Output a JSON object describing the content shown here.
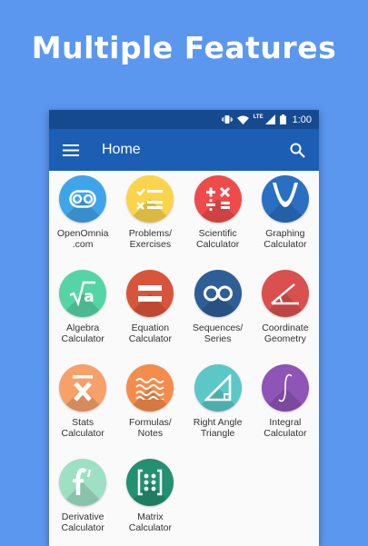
{
  "headline": "Multiple Features",
  "status_bar": {
    "network": "LTE",
    "time": "1:00"
  },
  "toolbar": {
    "title": "Home"
  },
  "colors": {
    "background": "#5b97ef",
    "status_bar": "#164a90",
    "app_bar": "#1b5eb4",
    "content": "#fafafa"
  },
  "features": [
    {
      "line1": "OpenOmnia",
      "line2": ".com",
      "color": "#3ea5ea",
      "icon": "infinity-chain-icon"
    },
    {
      "line1": "Problems/",
      "line2": "Exercises",
      "color": "#fbd44c",
      "icon": "checklist-icon"
    },
    {
      "line1": "Scientific",
      "line2": "Calculator",
      "color": "#ef4b4b",
      "icon": "math-operators-icon"
    },
    {
      "line1": "Graphing",
      "line2": "Calculator",
      "color": "#2a6fc2",
      "icon": "parabola-graph-icon"
    },
    {
      "line1": "Algebra",
      "line2": "Calculator",
      "color": "#55d5a5",
      "icon": "square-root-icon"
    },
    {
      "line1": "Equation",
      "line2": "Calculator",
      "color": "#d8553b",
      "icon": "equals-icon"
    },
    {
      "line1": "Sequences/",
      "line2": "Series",
      "color": "#2e5e96",
      "icon": "infinity-icon"
    },
    {
      "line1": "Coordinate",
      "line2": "Geometry",
      "color": "#d9504f",
      "icon": "angle-icon"
    },
    {
      "line1": "Stats",
      "line2": "Calculator",
      "color": "#f6a06a",
      "icon": "x-bar-icon"
    },
    {
      "line1": "Formulas/",
      "line2": "Notes",
      "color": "#f58c4c",
      "icon": "waves-icon"
    },
    {
      "line1": "Right Angle",
      "line2": "Triangle",
      "color": "#5cc7c7",
      "icon": "right-triangle-icon"
    },
    {
      "line1": "Integral",
      "line2": "Calculator",
      "color": "#8e54b6",
      "icon": "integral-icon"
    },
    {
      "line1": "Derivative",
      "line2": "Calculator",
      "color": "#9ee0c4",
      "icon": "f-prime-icon"
    },
    {
      "line1": "Matrix",
      "line2": "Calculator",
      "color": "#239070",
      "icon": "matrix-icon"
    }
  ]
}
